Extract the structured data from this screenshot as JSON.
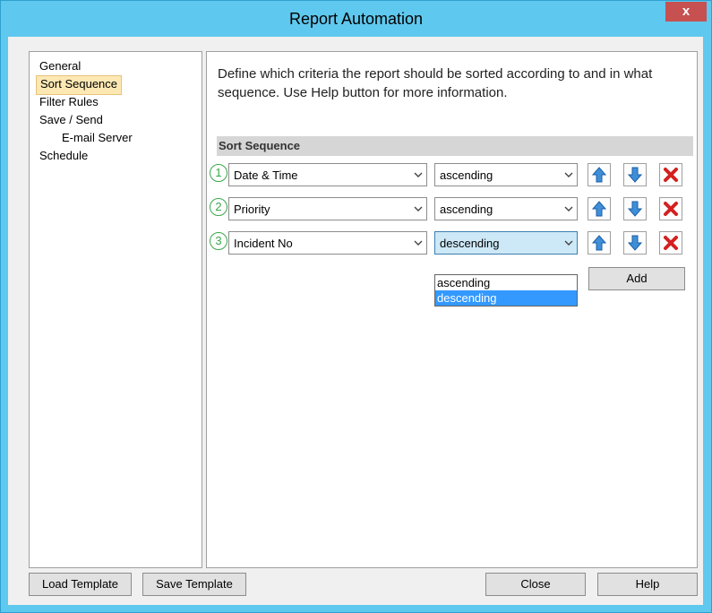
{
  "window": {
    "title": "Report Automation",
    "close_label": "x"
  },
  "nav": {
    "items": [
      {
        "label": "General"
      },
      {
        "label": "Sort Sequence"
      },
      {
        "label": "Filter Rules"
      },
      {
        "label": "Save / Send"
      },
      {
        "label": "E-mail Server"
      },
      {
        "label": "Schedule"
      }
    ],
    "selected": "Sort Sequence"
  },
  "panel": {
    "description": "Define which criteria the report should be sorted according to and in what sequence. Use Help button for more information.",
    "section_title": "Sort Sequence",
    "rows": [
      {
        "index": "1",
        "field": "Date & Time",
        "order": "ascending"
      },
      {
        "index": "2",
        "field": "Priority",
        "order": "ascending"
      },
      {
        "index": "3",
        "field": "Incident No",
        "order": "descending"
      }
    ],
    "dropdown_options": [
      "ascending",
      "descending"
    ],
    "dropdown_highlighted": "descending",
    "add_label": "Add"
  },
  "footer": {
    "load_template": "Load Template",
    "save_template": "Save Template",
    "close": "Close",
    "help": "Help"
  },
  "icons": {
    "move_up": "arrow-up-icon",
    "move_down": "arrow-down-icon",
    "delete": "delete-x-icon",
    "chevron": "chevron-down-icon"
  },
  "colors": {
    "titlebar": "#5fc8ee",
    "selected_nav": "#fde8b4",
    "highlight": "#3399ff",
    "index_green": "#3aa64a",
    "delete_red": "#d42020"
  }
}
